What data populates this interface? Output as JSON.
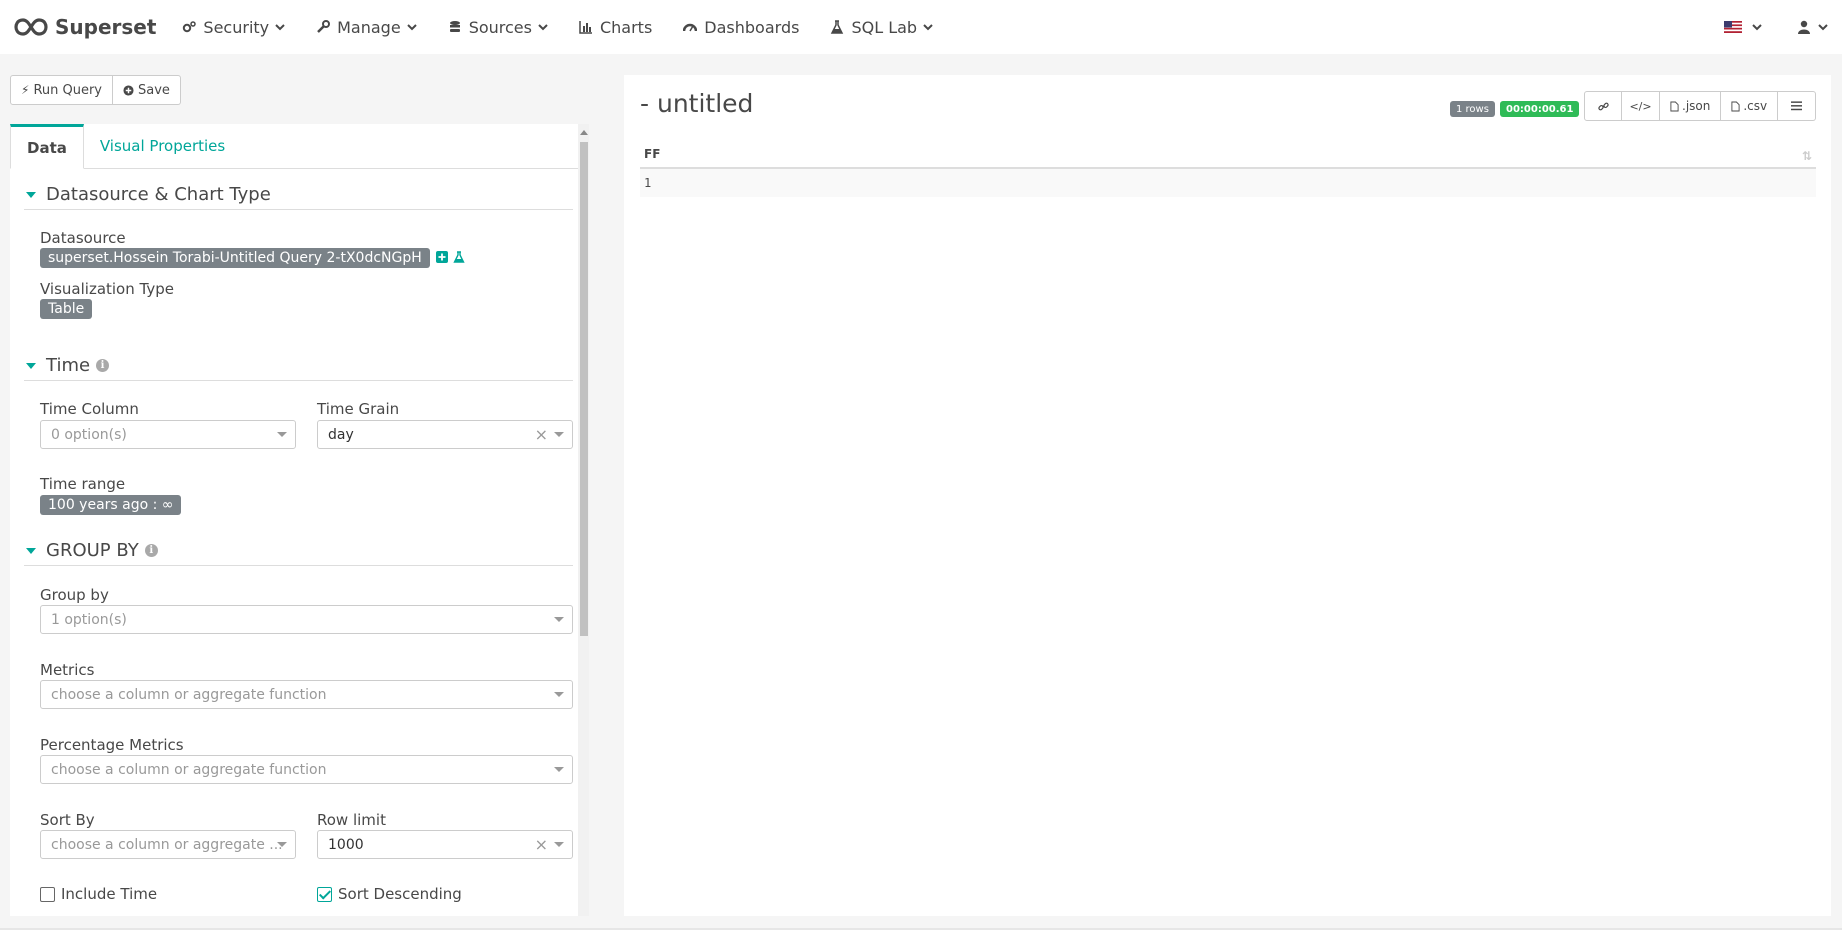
{
  "navbar": {
    "brand": "Superset",
    "items": [
      {
        "label": "Security",
        "icon": "cogs-icon",
        "dropdown": true
      },
      {
        "label": "Manage",
        "icon": "wrench-icon",
        "dropdown": true
      },
      {
        "label": "Sources",
        "icon": "database-icon",
        "dropdown": true
      },
      {
        "label": "Charts",
        "icon": "bar-chart-icon",
        "dropdown": false
      },
      {
        "label": "Dashboards",
        "icon": "dashboard-icon",
        "dropdown": false
      },
      {
        "label": "SQL Lab",
        "icon": "flask-icon",
        "dropdown": true
      }
    ],
    "language_icon": "us-flag-icon",
    "user_icon": "user-icon"
  },
  "toolbar": {
    "run_query_label": "Run Query",
    "save_label": "Save"
  },
  "tabs": [
    {
      "label": "Data",
      "active": true
    },
    {
      "label": "Visual Properties",
      "active": false
    }
  ],
  "sections": {
    "datasource_chart": {
      "title": "Datasource & Chart Type",
      "datasource_label": "Datasource",
      "datasource_value": "superset.Hossein Torabi-Untitled Query 2-tX0dcNGpH",
      "viz_type_label": "Visualization Type",
      "viz_type_value": "Table"
    },
    "time": {
      "title": "Time",
      "time_column_label": "Time Column",
      "time_column_placeholder": "0 option(s)",
      "time_grain_label": "Time Grain",
      "time_grain_value": "day",
      "time_range_label": "Time range",
      "time_range_value": "100 years ago : ∞"
    },
    "group_by": {
      "title": "GROUP BY",
      "group_by_label": "Group by",
      "group_by_placeholder": "1 option(s)",
      "metrics_label": "Metrics",
      "metrics_placeholder": "choose a column or aggregate function",
      "percentage_metrics_label": "Percentage Metrics",
      "percentage_metrics_placeholder": "choose a column or aggregate function",
      "sort_by_label": "Sort By",
      "sort_by_placeholder": "choose a column or aggregate ...",
      "row_limit_label": "Row limit",
      "row_limit_value": "1000",
      "include_time_label": "Include Time",
      "include_time_checked": false,
      "sort_descending_label": "Sort Descending",
      "sort_descending_checked": true
    }
  },
  "chart": {
    "title": "- untitled",
    "rows_badge": "1 rows",
    "time_badge": "00:00:00.61",
    "actions": {
      "json_label": ".json",
      "csv_label": ".csv"
    },
    "table": {
      "columns": [
        "FF"
      ],
      "rows": [
        [
          "1"
        ]
      ]
    }
  },
  "colors": {
    "accent": "#00A699",
    "badge_gray": "#7a8288",
    "success": "#2fbb57"
  }
}
